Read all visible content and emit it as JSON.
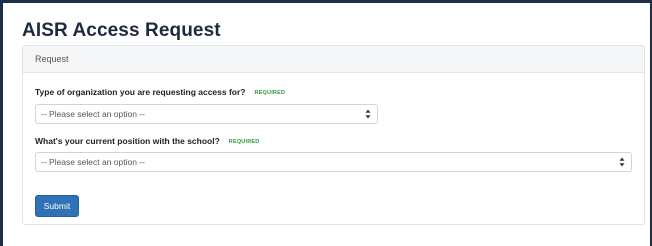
{
  "page": {
    "title": "AISR Access Request"
  },
  "panel": {
    "heading": "Request"
  },
  "fields": [
    {
      "label": "Type of organization you are requesting access for?",
      "required": "REQUIRED",
      "selected": "-- Please select an option --"
    },
    {
      "label": "What's your current position with the school?",
      "required": "REQUIRED",
      "selected": "-- Please select an option --"
    }
  ],
  "actions": {
    "submit_label": "Submit"
  },
  "colors": {
    "frame_border": "#1f2d4a",
    "required_badge": "#2e9a3a",
    "primary_button": "#2f72b6"
  }
}
